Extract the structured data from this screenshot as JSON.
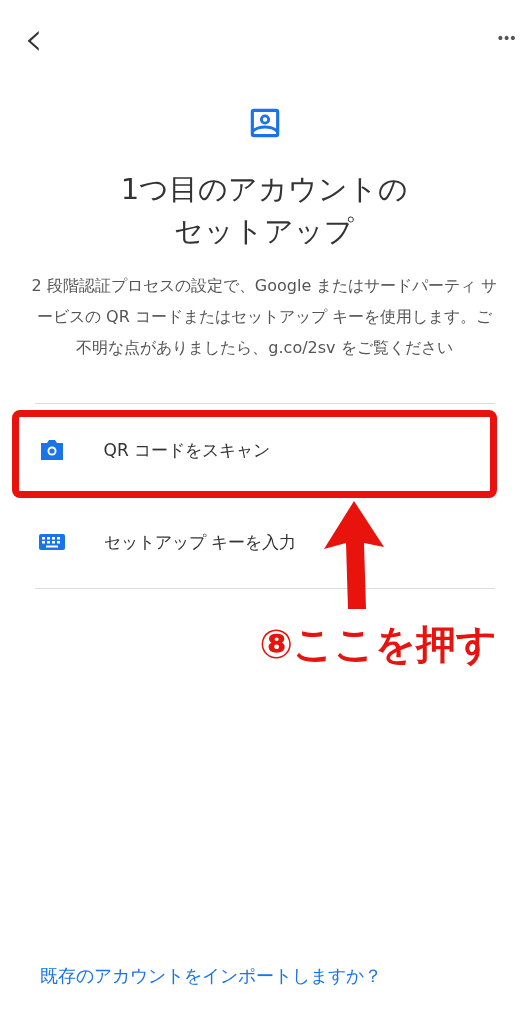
{
  "header": {
    "back": "‹",
    "more": "•••"
  },
  "title_lines": [
    "1つ目のアカウントの",
    "セットアップ"
  ],
  "description": "2 段階認証プロセスの設定で、Google またはサードパーティ サービスの QR コードまたはセットアップ キーを使用します。ご不明な点がありましたら、g.co/2sv をご覧ください",
  "options": [
    {
      "kind": "camera",
      "label": "QR コードをスキャン",
      "highlighted": true
    },
    {
      "kind": "keyboard",
      "label": "セットアップ キーを入力",
      "highlighted": false
    }
  ],
  "annotation": "⑧ここを押す",
  "import_link": "既存のアカウントをインポートしますか？"
}
